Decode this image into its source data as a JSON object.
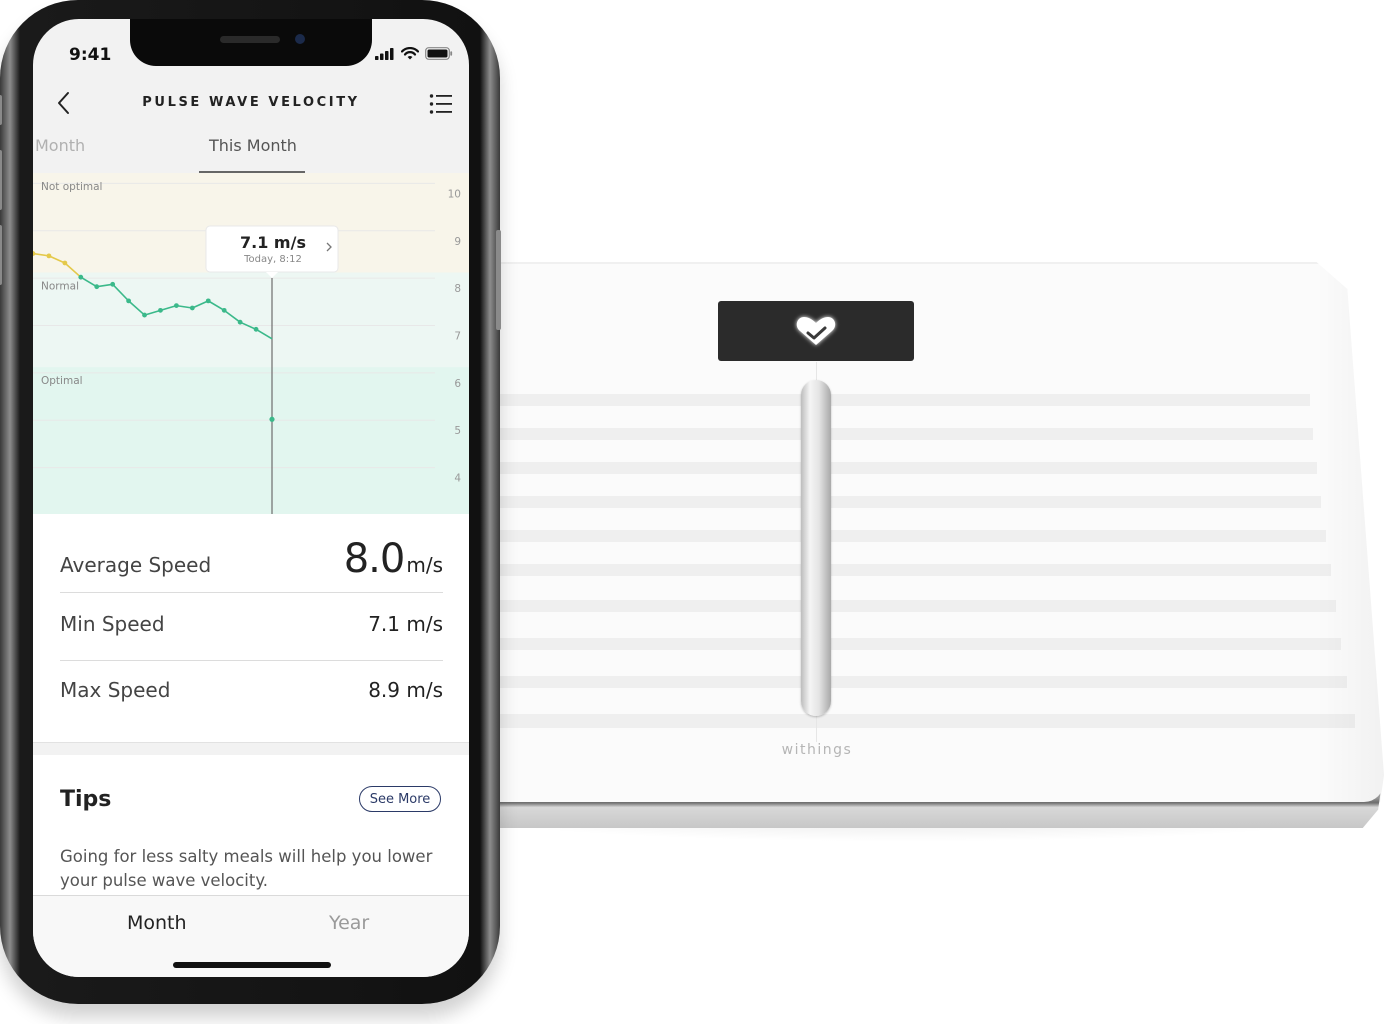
{
  "status_bar": {
    "time": "9:41"
  },
  "header": {
    "title": "PULSE WAVE VELOCITY",
    "back_icon": "chevron-left-icon",
    "menu_icon": "list-icon"
  },
  "period_tabs": [
    {
      "label": "Month",
      "state": "previous"
    },
    {
      "label": "This Month",
      "state": "selected"
    }
  ],
  "chart_data": {
    "type": "line",
    "title": "Pulse Wave Velocity",
    "ylabel": "m/s",
    "xlabel": "",
    "ylim": [
      3.4,
      10.6
    ],
    "yticks": [
      10,
      9,
      8,
      7,
      6,
      5,
      4
    ],
    "grid": true,
    "zones": [
      {
        "name": "Not optimal",
        "from": 8.5,
        "to": 10.6,
        "color": "#f8f5ea"
      },
      {
        "name": "Normal",
        "from": 6.5,
        "to": 8.5,
        "color": "#edf7f3"
      },
      {
        "name": "Optimal",
        "from": 3.4,
        "to": 6.5,
        "color": "#e2f6ef"
      }
    ],
    "series": [
      {
        "name": "Pulse wave velocity",
        "x": [
          0,
          1,
          2,
          3,
          4,
          5,
          6,
          7,
          8,
          9,
          10,
          11,
          12,
          13,
          14,
          15
        ],
        "values": [
          8.9,
          8.85,
          8.7,
          8.4,
          8.2,
          8.25,
          7.9,
          7.6,
          7.7,
          7.8,
          7.75,
          7.9,
          7.7,
          7.45,
          7.3,
          7.1
        ],
        "color_above_threshold": "#e4c94a",
        "color_below_threshold": "#3bb98a",
        "threshold": 8.5
      }
    ],
    "extra_point": {
      "x": 15,
      "value": 5.4
    },
    "x_max": 25,
    "cursor": {
      "x": 15,
      "value_label": "7.1 m/s",
      "time_label": "Today, 8:12"
    }
  },
  "stats": {
    "average": {
      "label": "Average Speed",
      "value": "8.0",
      "unit": "m/s"
    },
    "min": {
      "label": "Min Speed",
      "value": "7.1 m/s"
    },
    "max": {
      "label": "Max Speed",
      "value": "8.9 m/s"
    }
  },
  "tips": {
    "title": "Tips",
    "see_more_label": "See More",
    "text": "Going for less salty meals will help you lower your pulse wave velocity."
  },
  "bottom_tabs": [
    {
      "label": "Month",
      "selected": true
    },
    {
      "label": "Year",
      "selected": false
    }
  ],
  "device": {
    "brand": "withings",
    "display_icon": "heart-check-icon"
  },
  "colors": {
    "accent_navy": "#2b3a67",
    "line_green": "#3bb98a",
    "line_yellow": "#e4c94a"
  }
}
